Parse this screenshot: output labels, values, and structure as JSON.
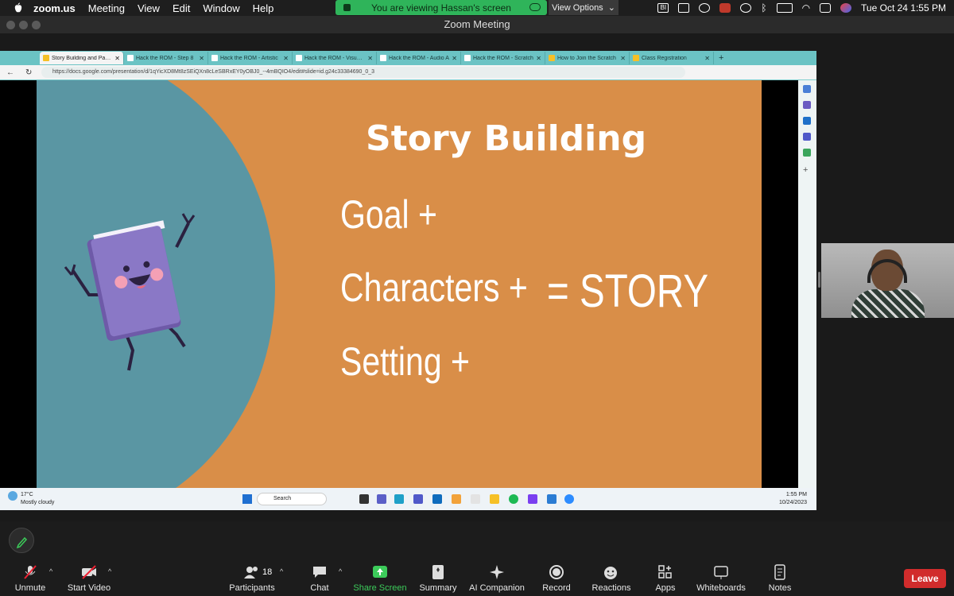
{
  "menubar": {
    "items": [
      "zoom.us",
      "Meeting",
      "View",
      "Edit",
      "Window",
      "Help"
    ],
    "share_banner": "You are viewing Hassan's screen",
    "view_options": "View Options",
    "clock": "Tue Oct 24  1:55 PM",
    "status_icons": [
      "bi-icon",
      "screens-icon",
      "play-icon",
      "cat-icon",
      "time-machine-icon",
      "bluetooth-icon",
      "battery-icon",
      "wifi-icon",
      "control-center-icon",
      "siri-icon"
    ]
  },
  "zoom": {
    "window_title": "Zoom Meeting"
  },
  "browser": {
    "tabs": [
      {
        "label": "Story Building and Paper"
      },
      {
        "label": "Hack the ROM - Step 8"
      },
      {
        "label": "Hack the ROM - Artistic"
      },
      {
        "label": "Hack the ROM - Visual A"
      },
      {
        "label": "Hack the ROM - Audio A"
      },
      {
        "label": "Hack the ROM - Scratch"
      },
      {
        "label": "How to Join the Scratch"
      },
      {
        "label": "Class Registration"
      }
    ],
    "url": "https://docs.google.com/presentation/d/1qYicXD8Mt8zSEiQXn8cLeSBRxEY0yOBJ0_--4mBQIO4/edit#slide=id.g24c33384690_0_3"
  },
  "slide": {
    "title": "Story Building",
    "line1": "Goal +",
    "line2": "Characters +",
    "line3": "Setting +",
    "result": "= STORY"
  },
  "taskbar": {
    "weather_temp": "17°C",
    "weather_desc": "Mostly cloudy",
    "search_placeholder": "Search",
    "time": "1:55 PM",
    "date": "10/24/2023"
  },
  "controls": {
    "unmute": "Unmute",
    "start_video": "Start Video",
    "participants": "Participants",
    "participants_count": "18",
    "chat": "Chat",
    "share_screen": "Share Screen",
    "summary": "Summary",
    "ai_companion": "AI Companion",
    "record": "Record",
    "reactions": "Reactions",
    "apps": "Apps",
    "whiteboards": "Whiteboards",
    "notes": "Notes",
    "leave": "Leave"
  },
  "colors": {
    "slide_bg": "#d98e48",
    "slide_circle": "#5a96a3",
    "share_green": "#2fb45a",
    "leave_red": "#d12c2c",
    "browser_accent": "#7ecfcf"
  }
}
